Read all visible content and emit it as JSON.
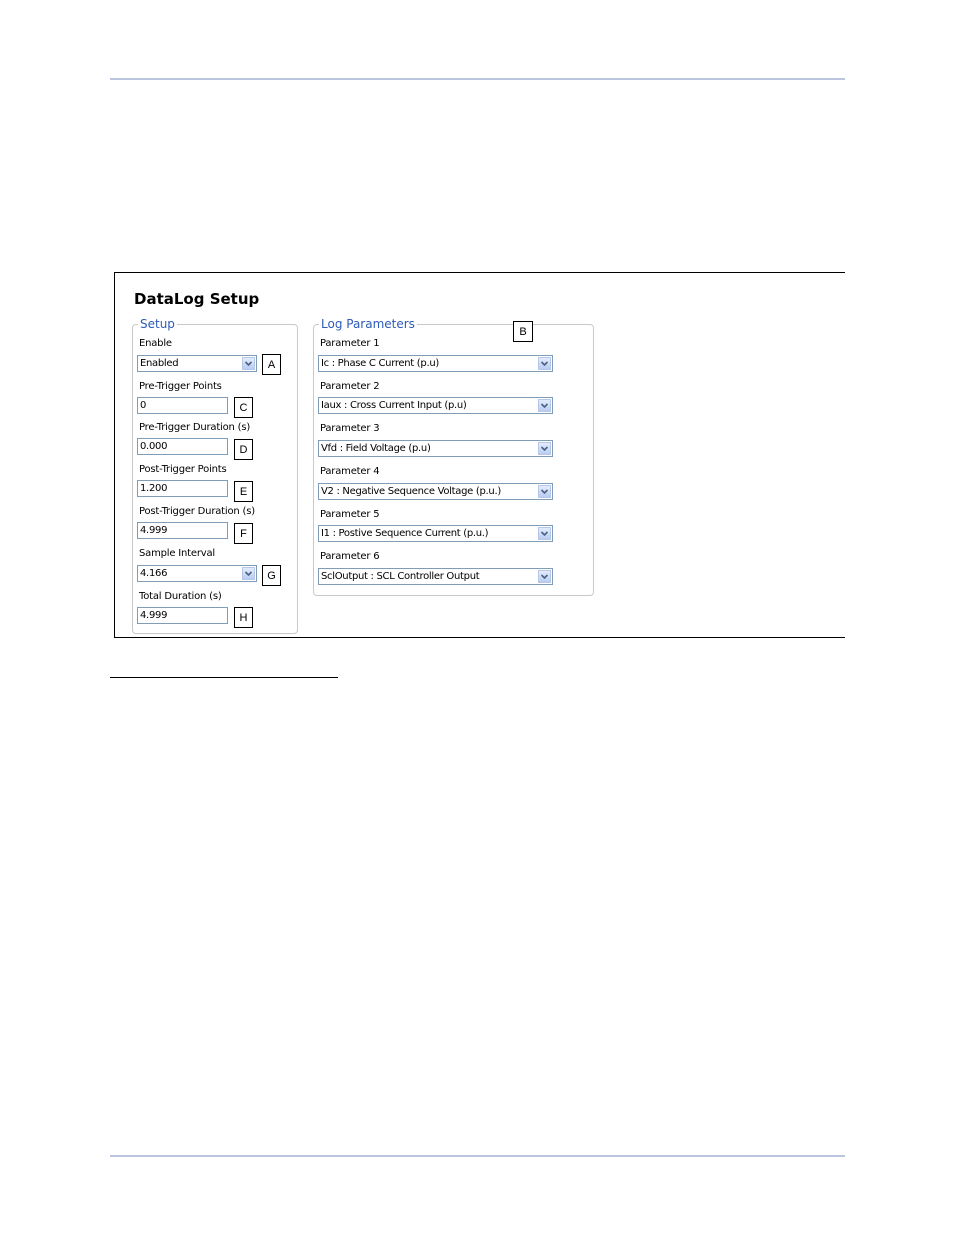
{
  "screen": {
    "title": "DataLog Setup"
  },
  "setup": {
    "legend": "Setup",
    "enable": {
      "label": "Enable",
      "value": "Enabled",
      "callout": "A"
    },
    "pre_trigger_points": {
      "label": "Pre-Trigger Points",
      "value": "0",
      "callout": "C"
    },
    "pre_trigger_duration": {
      "label": "Pre-Trigger Duration (s)",
      "value": "0.000",
      "callout": "D"
    },
    "post_trigger_points": {
      "label": "Post-Trigger Points",
      "value": "1.200",
      "callout": "E"
    },
    "post_trigger_duration": {
      "label": "Post-Trigger Duration (s)",
      "value": "4.999",
      "callout": "F"
    },
    "sample_interval": {
      "label": "Sample Interval",
      "value": "4.166",
      "callout": "G"
    },
    "total_duration": {
      "label": "Total Duration (s)",
      "value": "4.999",
      "callout": "H"
    }
  },
  "log_parameters": {
    "legend": "Log Parameters",
    "callout": "B",
    "items": [
      {
        "label": "Parameter 1",
        "value": "Ic : Phase C Current  (p.u)"
      },
      {
        "label": "Parameter 2",
        "value": "Iaux : Cross Current Input  (p.u)"
      },
      {
        "label": "Parameter 3",
        "value": "Vfd : Field Voltage  (p.u)"
      },
      {
        "label": "Parameter 4",
        "value": "V2 : Negative Sequence Voltage  (p.u.)"
      },
      {
        "label": "Parameter 5",
        "value": "I1 : Postive Sequence Current  (p.u.)"
      },
      {
        "label": "Parameter 6",
        "value": "SclOutput : SCL Controller Output"
      }
    ]
  },
  "colors": {
    "legend": "#2d5bb8",
    "rule": "#b9c6dd",
    "field_border": "#7f9db9"
  }
}
